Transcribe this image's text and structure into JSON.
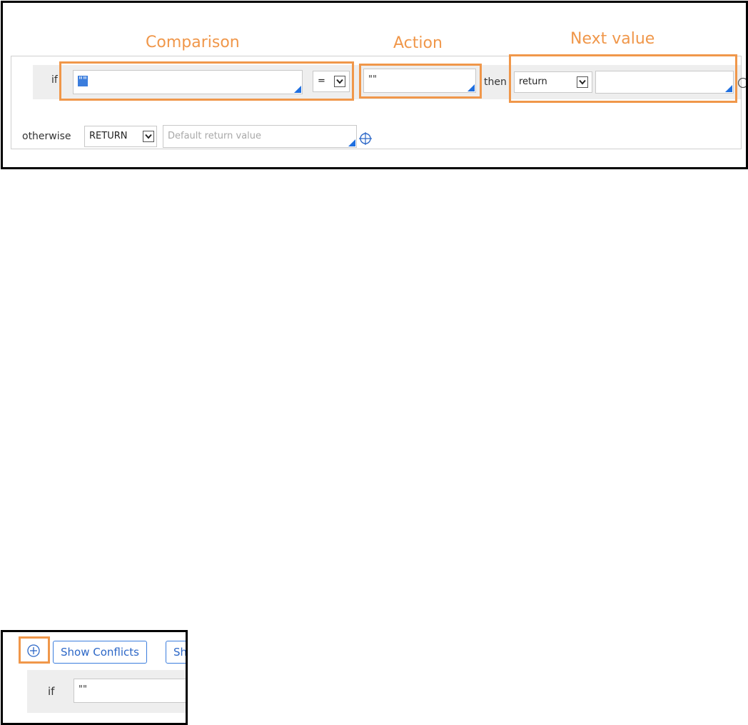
{
  "panel1": {
    "annotations": {
      "comparison": "Comparison",
      "action": "Action",
      "next_value": "Next value"
    },
    "rule": {
      "if_keyword": "if",
      "comparison_value": "\"\"",
      "operator": "=",
      "action_value": "\"\"",
      "then_keyword": "then",
      "return_mode": "return",
      "next_value": ""
    },
    "otherwise": {
      "keyword": "otherwise",
      "mode": "RETURN",
      "default_placeholder": "Default return value"
    }
  },
  "panel2": {
    "show_conflicts_label": "Show Conflicts",
    "partial_button_label": "Sh",
    "if_keyword": "if",
    "if_value": "\"\""
  },
  "colors": {
    "annotation": "#F0974A",
    "accent_blue": "#1F6FE0",
    "row_background": "#eeeeee"
  }
}
